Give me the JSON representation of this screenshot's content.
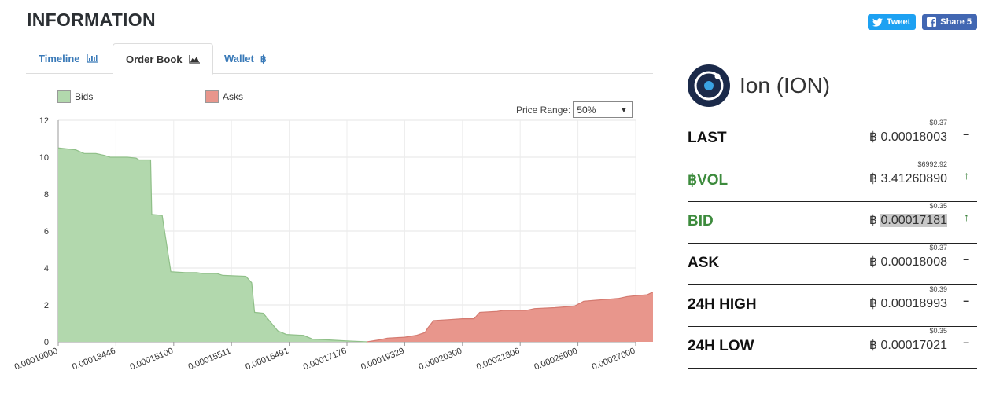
{
  "page": {
    "title": "INFORMATION"
  },
  "social": {
    "tweet_label": "Tweet",
    "share_label": "Share 5"
  },
  "tabs": [
    {
      "label": "Timeline",
      "icon": "bar-chart-icon",
      "active": false
    },
    {
      "label": "Order Book",
      "icon": "area-chart-icon",
      "active": true
    },
    {
      "label": "Wallet",
      "icon": "bitcoin-icon",
      "active": false
    }
  ],
  "price_range": {
    "label": "Price Range:",
    "value": "50%"
  },
  "colors": {
    "bids_fill": "#b2d8ad",
    "bids_line": "#8fbf88",
    "asks_fill": "#e8968c",
    "asks_line": "#d47a70",
    "green": "#3d8b3d"
  },
  "chart_data": {
    "type": "area",
    "legend": [
      "Bids",
      "Asks"
    ],
    "ylim": [
      0,
      12
    ],
    "yticks": [
      0,
      2,
      4,
      6,
      8,
      10,
      12
    ],
    "xtick_labels": [
      "0.00010000",
      "0.00013446",
      "0.00015100",
      "0.00015511",
      "0.00016491",
      "0.00017176",
      "0.00019329",
      "0.00020300",
      "0.00021806",
      "0.00025000",
      "0.00027000"
    ],
    "grid": true,
    "series": [
      {
        "name": "Bids",
        "points": [
          [
            0,
            10.5
          ],
          [
            0.3,
            10.4
          ],
          [
            0.45,
            10.2
          ],
          [
            0.65,
            10.2
          ],
          [
            0.8,
            10.1
          ],
          [
            0.9,
            10.0
          ],
          [
            1.2,
            10.0
          ],
          [
            1.35,
            9.95
          ],
          [
            1.4,
            9.85
          ],
          [
            1.6,
            9.85
          ],
          [
            1.62,
            6.9
          ],
          [
            1.8,
            6.85
          ],
          [
            1.95,
            3.8
          ],
          [
            2.2,
            3.75
          ],
          [
            2.4,
            3.75
          ],
          [
            2.5,
            3.7
          ],
          [
            2.75,
            3.7
          ],
          [
            2.85,
            3.6
          ],
          [
            3.25,
            3.55
          ],
          [
            3.35,
            3.2
          ],
          [
            3.4,
            1.6
          ],
          [
            3.55,
            1.55
          ],
          [
            3.8,
            0.6
          ],
          [
            3.95,
            0.4
          ],
          [
            4.25,
            0.35
          ],
          [
            4.4,
            0.15
          ],
          [
            4.7,
            0.1
          ],
          [
            5.0,
            0.05
          ],
          [
            5.35,
            0.0
          ]
        ]
      },
      {
        "name": "Asks",
        "points": [
          [
            5.35,
            0.0
          ],
          [
            5.55,
            0.1
          ],
          [
            5.7,
            0.2
          ],
          [
            6.0,
            0.25
          ],
          [
            6.2,
            0.35
          ],
          [
            6.35,
            0.5
          ],
          [
            6.4,
            0.75
          ],
          [
            6.5,
            1.15
          ],
          [
            6.75,
            1.2
          ],
          [
            7.0,
            1.25
          ],
          [
            7.2,
            1.25
          ],
          [
            7.3,
            1.6
          ],
          [
            7.6,
            1.65
          ],
          [
            7.7,
            1.7
          ],
          [
            8.1,
            1.7
          ],
          [
            8.25,
            1.8
          ],
          [
            8.6,
            1.85
          ],
          [
            8.8,
            1.9
          ],
          [
            8.95,
            1.95
          ],
          [
            9.1,
            2.2
          ],
          [
            9.3,
            2.25
          ],
          [
            9.5,
            2.3
          ],
          [
            9.7,
            2.35
          ],
          [
            9.85,
            2.45
          ],
          [
            10.0,
            2.5
          ],
          [
            10.2,
            2.55
          ],
          [
            10.3,
            2.7
          ]
        ]
      }
    ]
  },
  "coin": {
    "name": "Ion (ION)",
    "logo_icon": "ion-logo-icon"
  },
  "stats": [
    {
      "label": "LAST",
      "usd": "$0.37",
      "btc": "0.00018003",
      "trend": "–",
      "green": false,
      "highlight": false
    },
    {
      "label": "฿VOL",
      "usd": "$6992.92",
      "btc": "3.41260890",
      "trend": "↑",
      "green": true,
      "highlight": false
    },
    {
      "label": "BID",
      "usd": "$0.35",
      "btc": "0.00017181",
      "trend": "↑",
      "green": true,
      "highlight": true
    },
    {
      "label": "ASK",
      "usd": "$0.37",
      "btc": "0.00018008",
      "trend": "–",
      "green": false,
      "highlight": false
    },
    {
      "label": "24H HIGH",
      "usd": "$0.39",
      "btc": "0.00018993",
      "trend": "–",
      "green": false,
      "highlight": false
    },
    {
      "label": "24H LOW",
      "usd": "$0.35",
      "btc": "0.00017021",
      "trend": "–",
      "green": false,
      "highlight": false
    }
  ],
  "btc_symbol": "฿"
}
